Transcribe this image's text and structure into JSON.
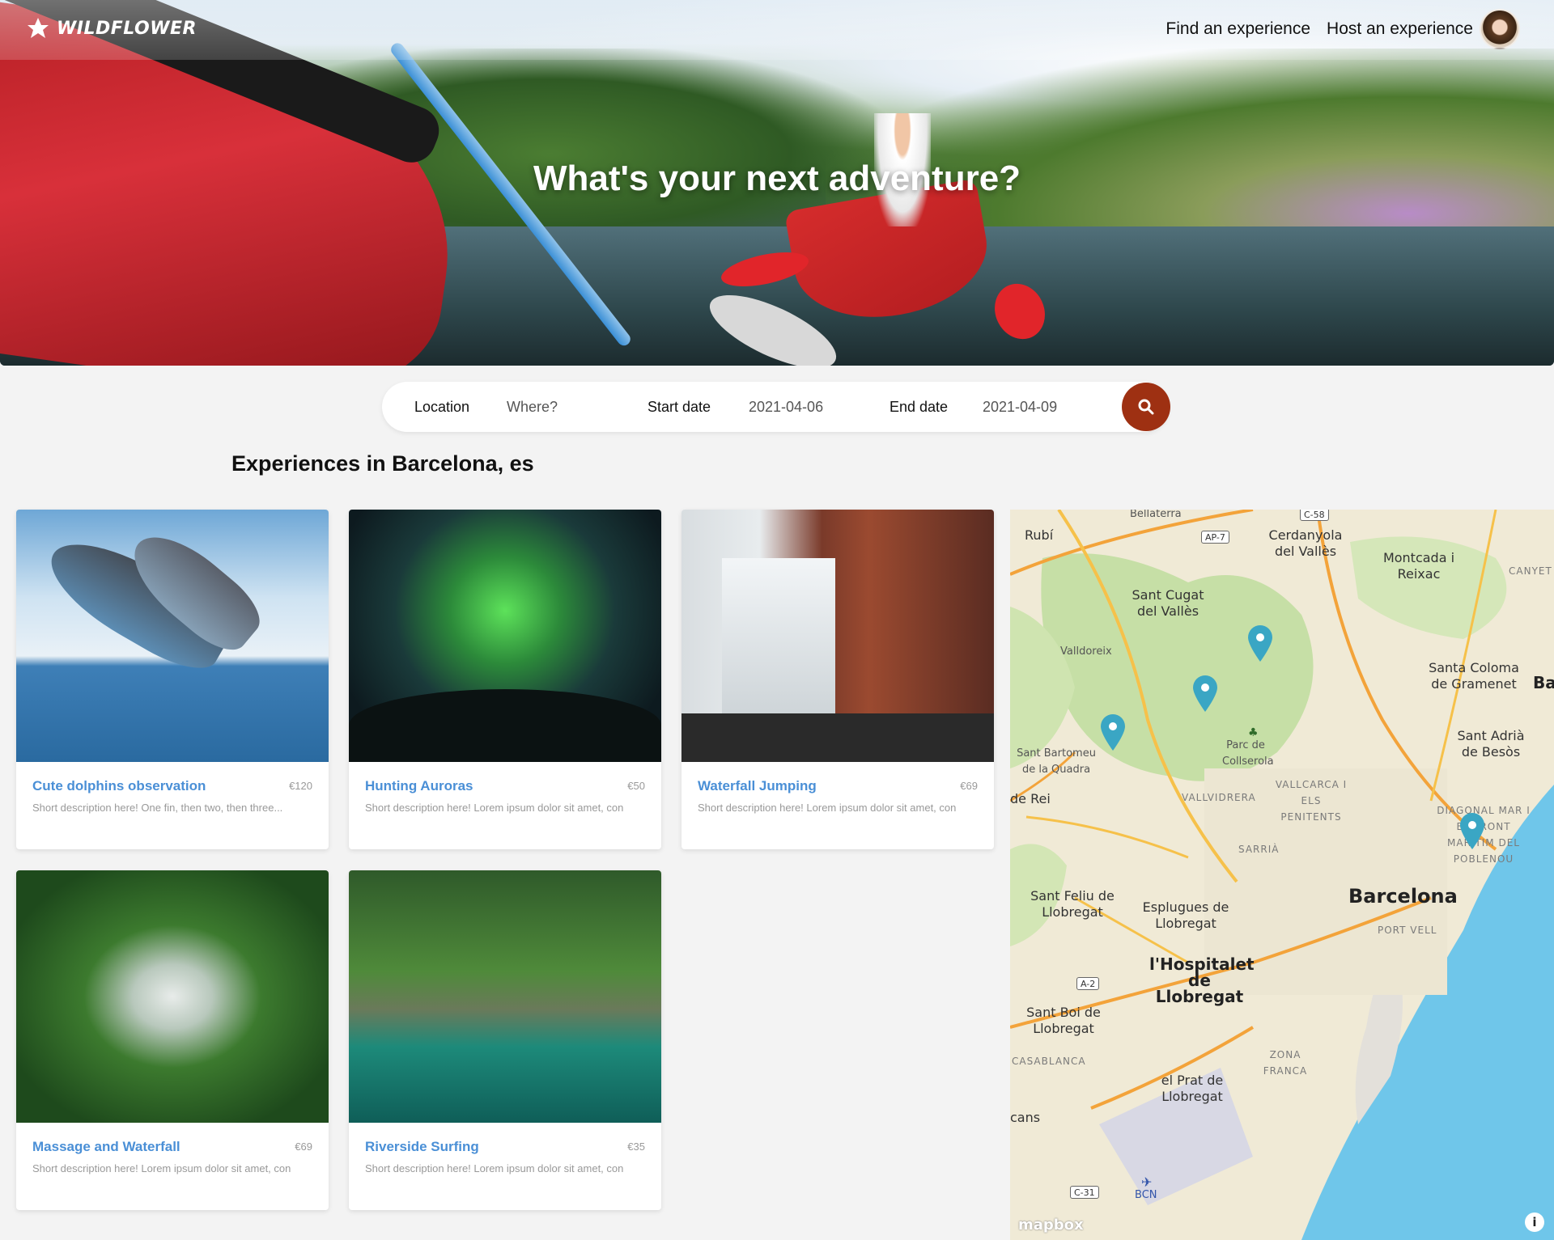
{
  "brand": {
    "name": "WILDFLOWER"
  },
  "nav": {
    "find": "Find an experience",
    "host": "Host an experience"
  },
  "hero": {
    "title": "What's your next adventure?"
  },
  "search": {
    "location_label": "Location",
    "location_placeholder": "Where?",
    "start_label": "Start date",
    "start_value": "2021-04-06",
    "end_label": "End date",
    "end_value": "2021-04-09",
    "button_icon": "search-icon"
  },
  "section_title": "Experiences in Barcelona, es",
  "experiences": [
    {
      "title": "Cute dolphins observation",
      "price": "€120",
      "desc": "Short description here! One fin, then two, then three..."
    },
    {
      "title": "Hunting Auroras",
      "price": "€50",
      "desc": "Short description here! Lorem ipsum dolor sit amet, con"
    },
    {
      "title": "Waterfall Jumping",
      "price": "€69",
      "desc": "Short description here! Lorem ipsum dolor sit amet, con"
    },
    {
      "title": "Massage and Waterfall",
      "price": "€69",
      "desc": "Short description here! Lorem ipsum dolor sit amet, con"
    },
    {
      "title": "Riverside Surfing",
      "price": "€35",
      "desc": "Short description here! Lorem ipsum dolor sit amet, con"
    }
  ],
  "map": {
    "labels": {
      "bellaterra": "Bellaterra",
      "rubi": "Rubí",
      "cerdanyola": "Cerdanyola del Vallès",
      "montcada": "Montcada i Reixac",
      "canyet": "CANYET",
      "santcugat": "Sant Cugat del Vallès",
      "valldoreix": "Valldoreix",
      "santacoloma": "Santa Coloma de Gramenet",
      "ba": "Ba",
      "santbartomeu": "Sant Bartomeu de la Quadra",
      "parc": "Parc de Collserola",
      "santadria": "Sant Adrià de Besòs",
      "derei": "de Rei",
      "vallvidrera": "VALLVIDRERA",
      "vallcarca": "VALLCARCA I ELS PENITENTS",
      "diagonal": "DIAGONAL MAR I EL FRONT MARÍTIM DEL POBLENOU",
      "sarria": "SARRIÀ",
      "santfeliu": "Sant Feliu de Llobregat",
      "esplugues": "Esplugues de Llobregat",
      "barcelona": "Barcelona",
      "portvell": "PORT VELL",
      "hospitalet": "l'Hospitalet de Llobregat",
      "santboi": "Sant Boi de Llobregat",
      "casablanca": "CASABLANCA",
      "zonafranca": "ZONA FRANCA",
      "elprat": "el Prat de Llobregat",
      "cans": "cans",
      "bcn": "BCN"
    },
    "roads": {
      "c58": "C-58",
      "ap7": "AP-7",
      "a2": "A-2",
      "c31": "C-31"
    },
    "attribution": "mapbox",
    "info": "i",
    "accent": "#3aa6c4"
  },
  "colors": {
    "accent": "#4a8fd6",
    "search_button": "#9e3012"
  }
}
